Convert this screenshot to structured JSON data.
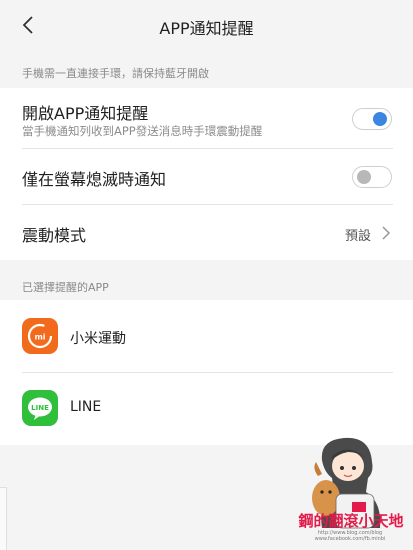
{
  "header": {
    "title": "APP通知提醒",
    "back_icon": "chevron-left-icon"
  },
  "notice": "手機需一直連接手環，請保持藍牙開啟",
  "settings": {
    "app_notify": {
      "title": "開啟APP通知提醒",
      "subtitle": "當手機通知列收到APP發送消息時手環震動提醒",
      "enabled": true
    },
    "screen_off": {
      "title": "僅在螢幕熄滅時通知",
      "enabled": false
    },
    "vibration": {
      "title": "震動模式",
      "value": "預設"
    }
  },
  "apps_section": "已選擇提醒的APP",
  "apps": [
    {
      "name": "小米運動",
      "icon": "mi-fit-icon",
      "color": "#f26b1d"
    },
    {
      "name": "LINE",
      "icon": "line-icon",
      "color": "#2fbf3a"
    }
  ],
  "watermark": {
    "text": "鋼的翻滾小天地",
    "url": "http://www.blog.com/blog  www.facebook.com/fb.minbi"
  },
  "colors": {
    "accent": "#3a86e0",
    "watermark": "#e21b4a"
  }
}
